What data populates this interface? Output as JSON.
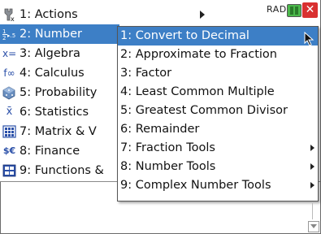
{
  "status": {
    "angle_mode": "RAD",
    "close_label": "✕"
  },
  "menu": {
    "items": [
      {
        "label": "1: Actions",
        "icon": "actions-icon",
        "glyph": "🔧"
      },
      {
        "label": "2: Number",
        "icon": "number-icon",
        "glyph": "½"
      },
      {
        "label": "3: Algebra",
        "icon": "algebra-icon",
        "glyph": "x="
      },
      {
        "label": "4: Calculus",
        "icon": "calculus-icon",
        "glyph": "f∞"
      },
      {
        "label": "5: Probability",
        "icon": "probability-icon",
        "glyph": "⬢"
      },
      {
        "label": "6: Statistics",
        "icon": "statistics-icon",
        "glyph": "x̄"
      },
      {
        "label": "7: Matrix & V",
        "icon": "matrix-icon",
        "glyph": "▦"
      },
      {
        "label": "8: Finance",
        "icon": "finance-icon",
        "glyph": "$€"
      },
      {
        "label": "9: Functions &",
        "icon": "functions-icon",
        "glyph": "▣"
      }
    ],
    "selected_index": 1
  },
  "submenu": {
    "items": [
      {
        "label": "1: Convert to Decimal",
        "has_submenu": false
      },
      {
        "label": "2: Approximate to Fraction",
        "has_submenu": false
      },
      {
        "label": "3: Factor",
        "has_submenu": false
      },
      {
        "label": "4: Least Common Multiple",
        "has_submenu": false
      },
      {
        "label": "5: Greatest Common Divisor",
        "has_submenu": false
      },
      {
        "label": "6: Remainder",
        "has_submenu": false
      },
      {
        "label": "7: Fraction Tools",
        "has_submenu": true
      },
      {
        "label": "8: Number Tools",
        "has_submenu": true
      },
      {
        "label": "9: Complex Number Tools",
        "has_submenu": true
      }
    ],
    "selected_index": 0
  },
  "colors": {
    "highlight": "#3d7fc6",
    "close_button": "#d93030",
    "battery": "#4bb84b"
  }
}
